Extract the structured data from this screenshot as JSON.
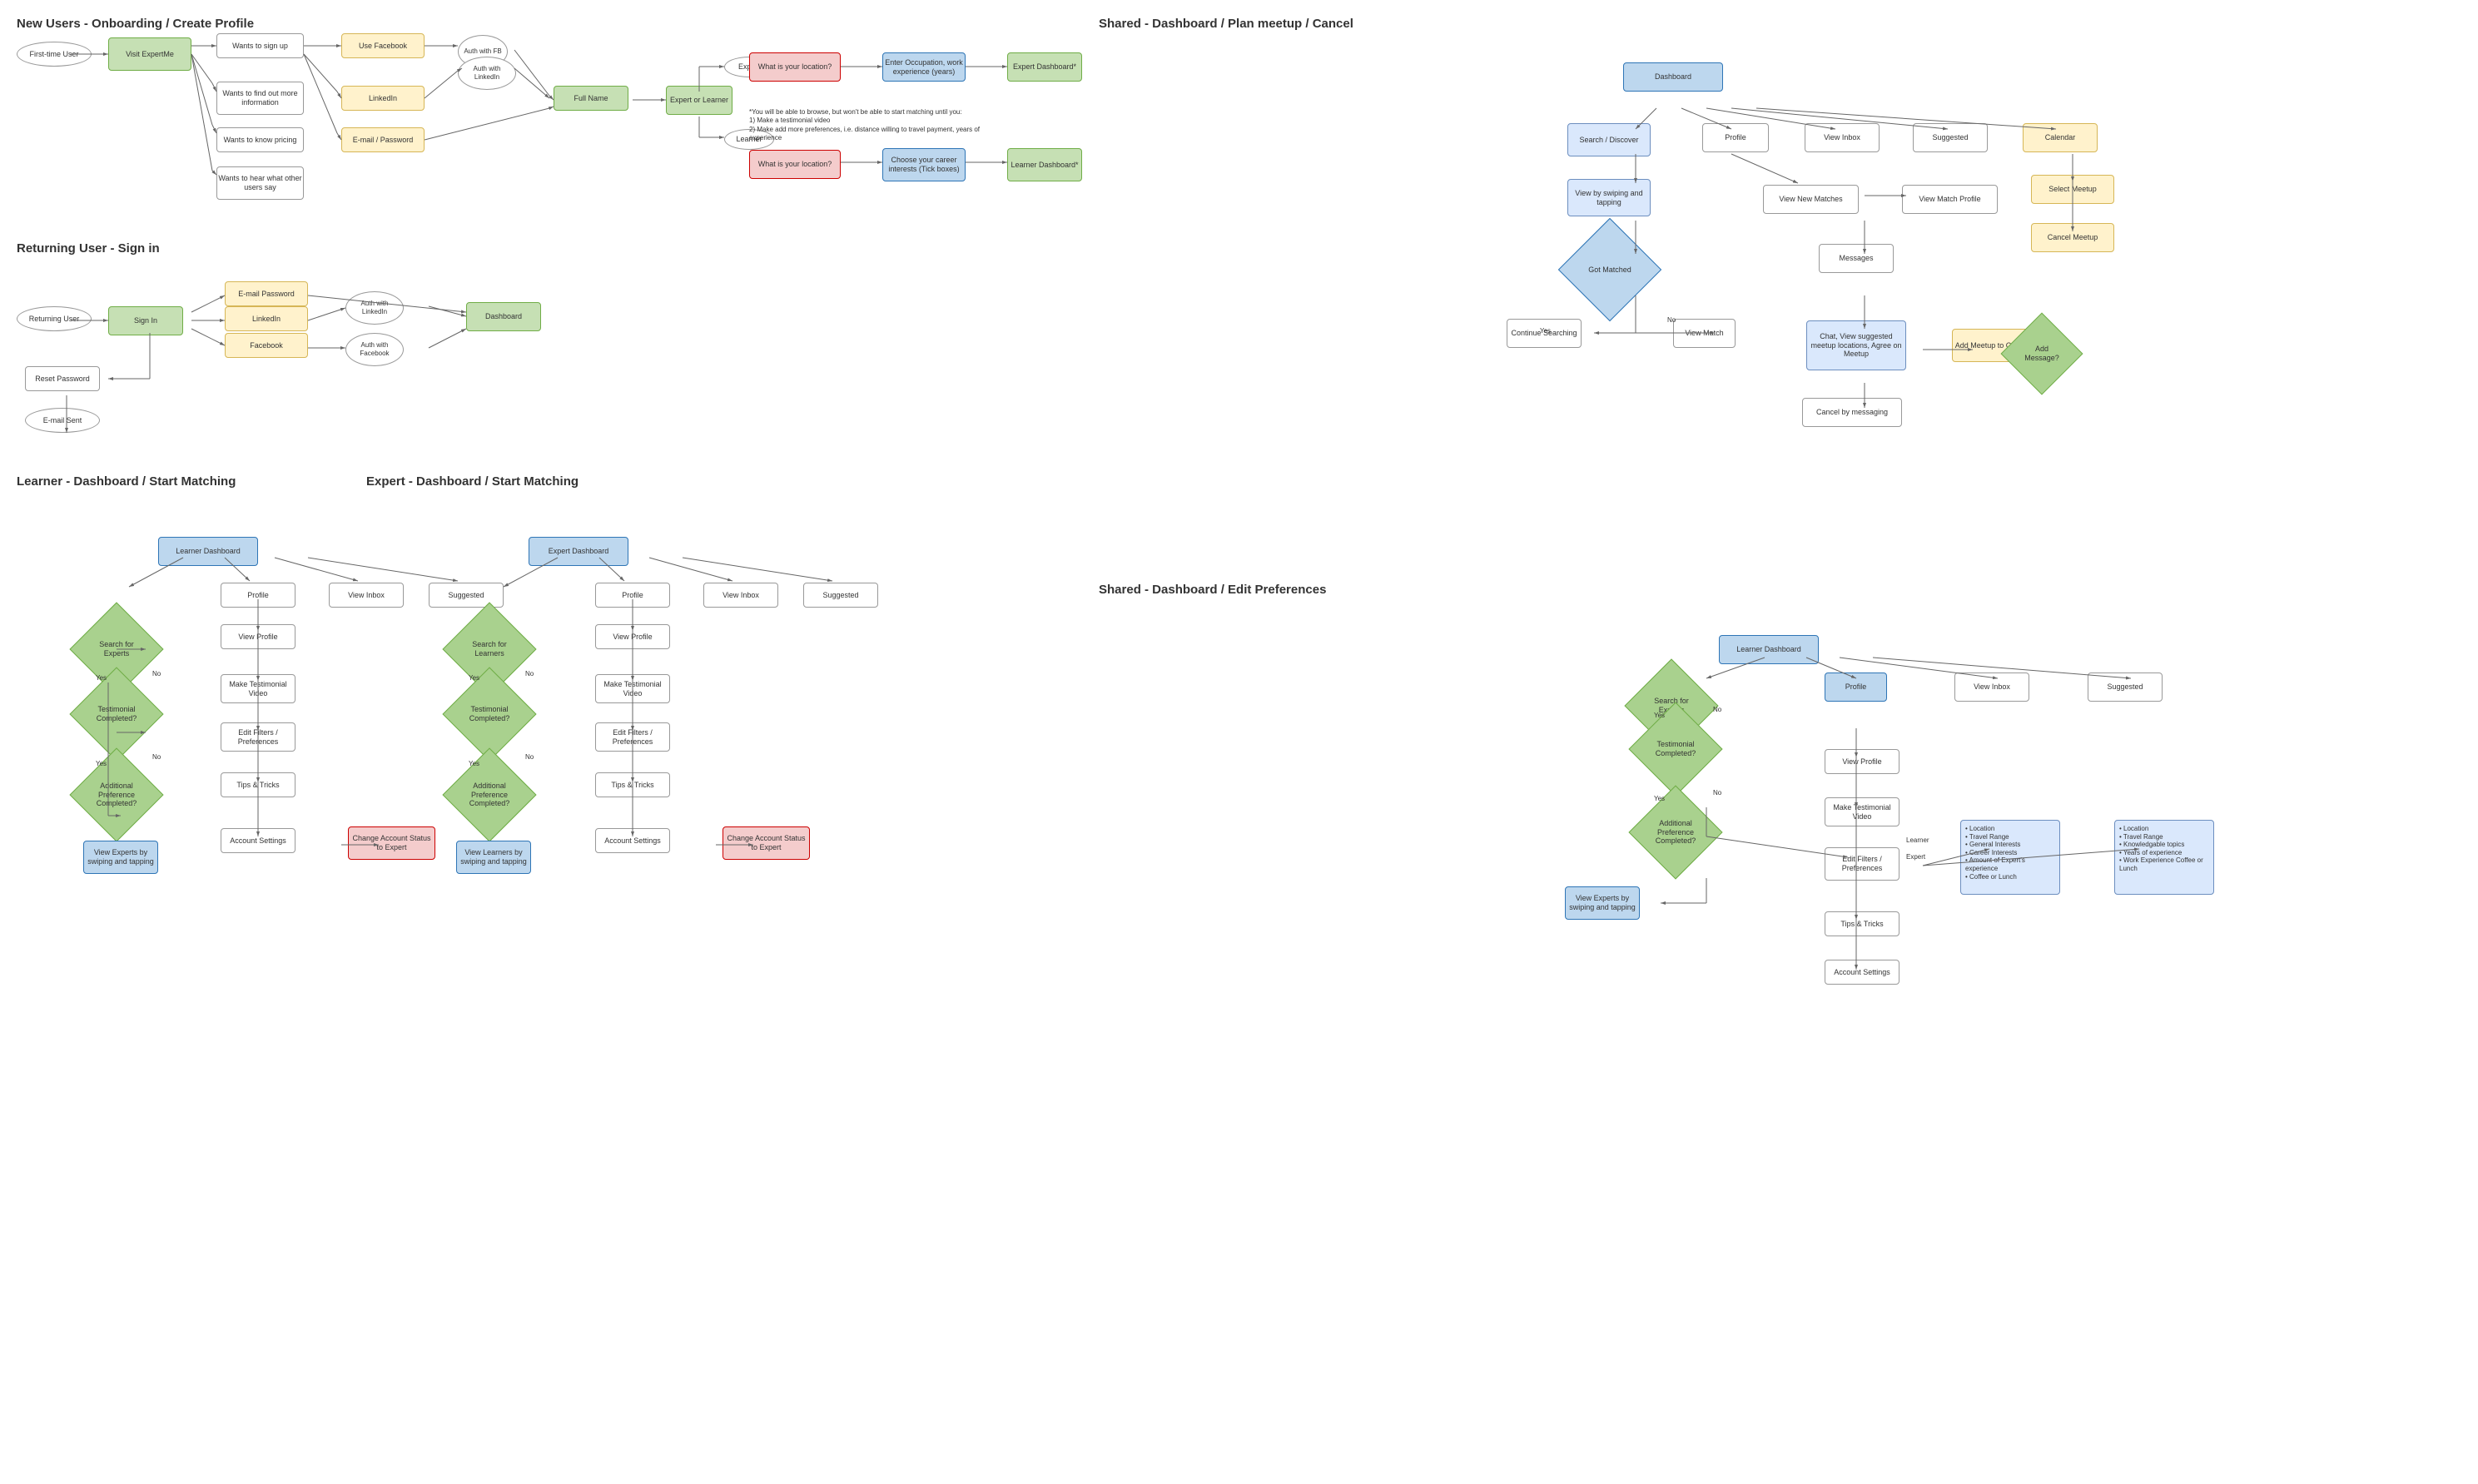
{
  "sections": {
    "new_users": {
      "title": "New Users - Onboarding / Create Profile",
      "nodes": {
        "first_time_user": "First-time User",
        "visit_expertme": "Visit ExpertMe",
        "wants_sign_up": "Wants to sign up",
        "wants_find_more": "Wants to find out more information",
        "wants_pricing": "Wants to know pricing",
        "wants_hear": "Wants to hear what other users say",
        "use_facebook": "Use Facebook",
        "linkedin": "LinkedIn",
        "email_password": "E-mail / Password",
        "auth_fb": "Auth with FB",
        "auth_linkedin": "Auth with LinkedIn",
        "full_name": "Full Name",
        "expert_or_learner": "Expert or Learner",
        "expert": "Expert",
        "learner": "Learner",
        "what_occupation": "What is your location?",
        "enter_occupation": "Enter Occupation, work experience (years)",
        "expert_dashboard": "Expert Dashboard*",
        "what_location": "What is your location?",
        "choose_career": "Choose your career interests (Tick boxes)",
        "learner_dashboard": "Learner Dashboard*"
      },
      "note": "*You will be able to browse, but won't be able to start matching until you:\n1) Make a testimonial video\n2) Make add more preferences, i.e. distance willing to travel payment, years of experience"
    },
    "returning_user": {
      "title": "Returning User - Sign in",
      "nodes": {
        "returning_user": "Returning User",
        "sign_in": "Sign In",
        "email_password": "E-mail Password",
        "linkedin": "LinkedIn",
        "facebook": "Facebook",
        "auth_linkedin": "Auth with LinkedIn",
        "auth_facebook": "Auth with Facebook",
        "dashboard": "Dashboard",
        "reset_password": "Reset Password",
        "email_sent": "E-mail Sent"
      }
    },
    "learner_dashboard": {
      "title": "Learner - Dashboard / Start Matching",
      "nodes": {
        "learner_dashboard": "Learner Dashboard",
        "search_experts": "Search for Experts",
        "profile": "Profile",
        "view_inbox": "View Inbox",
        "suggested": "Suggested",
        "testimonial_completed": "Testimonial Completed?",
        "view_profile": "View Profile",
        "make_testimonial": "Make Testimonial Video",
        "additional_pref": "Additional Preference Completed?",
        "edit_filters": "Edit Filters / Preferences",
        "tips_tricks": "Tips & Tricks",
        "view_experts": "View Experts by swiping and tapping",
        "account_settings": "Account Settings",
        "change_account": "Change Account Status to Expert"
      }
    },
    "expert_dashboard": {
      "title": "Expert - Dashboard / Start Matching",
      "nodes": {
        "expert_dashboard": "Expert Dashboard",
        "search_learners": "Search for Learners",
        "profile": "Profile",
        "view_inbox": "View Inbox",
        "suggested": "Suggested",
        "testimonial_completed": "Testimonial Completed?",
        "view_profile": "View Profile",
        "make_testimonial": "Make Testimonial Video",
        "additional_pref": "Additional Preference Completed?",
        "edit_filters": "Edit Filters / Preferences",
        "tips_tricks": "Tips & Tricks",
        "view_learners": "View Learners by swiping and tapping",
        "account_settings": "Account Settings",
        "change_account": "Change Account Status to Expert"
      }
    },
    "shared_dashboard_plan": {
      "title": "Shared - Dashboard / Plan meetup / Cancel",
      "nodes": {
        "dashboard": "Dashboard",
        "search_discover": "Search / Discover",
        "profile": "Profile",
        "view_inbox": "View Inbox",
        "suggested": "Suggested",
        "calendar": "Calendar",
        "view_swiping": "View by swiping and tapping",
        "view_new_matches": "View New Matches",
        "view_match_profile": "View Match Profile",
        "got_matched": "Got Matched",
        "messages": "Messages",
        "select_meetup": "Select Meetup",
        "cancel_meetup": "Cancel Meetup",
        "continue_searching": "Continue Searching",
        "view_match": "View Match",
        "chat_view": "Chat, View suggested meetup locations, Agree on Meetup",
        "add_meetup": "Add Meetup to Calendar",
        "cancel_by_messaging": "Cancel by messaging",
        "add_message": "Add Message?"
      }
    },
    "shared_dashboard_edit": {
      "title": "Shared - Dashboard / Edit Preferences",
      "nodes": {
        "learner_dashboard": "Learner Dashboard",
        "search_experts": "Search for Experts",
        "profile": "Profile",
        "view_inbox": "View Inbox",
        "suggested": "Suggested",
        "testimonial_completed": "Testimonial Completed?",
        "additional_pref": "Additional Preference Completed?",
        "view_profile": "View Profile",
        "make_testimonial": "Make Testimonial Video",
        "edit_filters": "Edit Filters / Preferences",
        "tips_tricks": "Tips & Tricks",
        "view_experts": "View Experts by swiping and tapping",
        "account_settings": "Account Settings",
        "learner_options": "Location\nTravel Range\nGeneral Interests\nCareer Interests\nAmount of Expert's experience\nCoffee or Lunch",
        "expert_options": "Location\nTravel Range\nKnowledgable topics\nYears of experience\nWork Experience Coffee or Lunch"
      }
    }
  }
}
